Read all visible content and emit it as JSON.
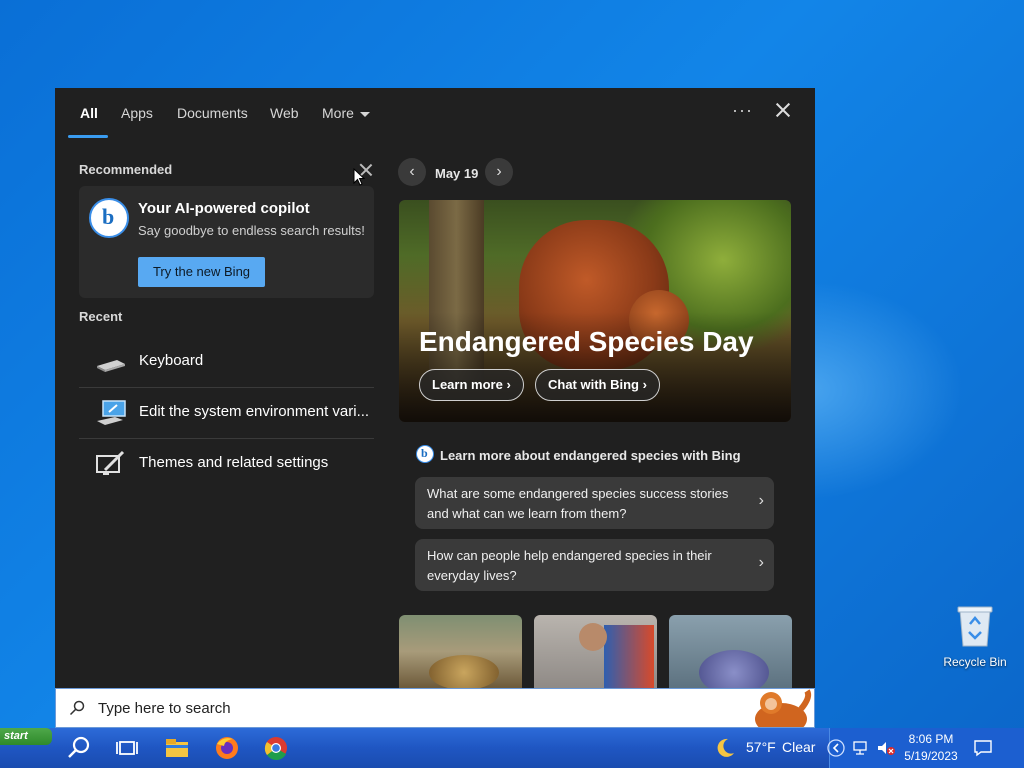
{
  "tabs": [
    {
      "label": "All",
      "active": true
    },
    {
      "label": "Apps"
    },
    {
      "label": "Documents"
    },
    {
      "label": "Web"
    },
    {
      "label": "More"
    }
  ],
  "recommended": {
    "title": "Recommended",
    "card": {
      "title": "Your AI-powered copilot",
      "subtitle": "Say goodbye to endless search results!",
      "button": "Try the new Bing"
    }
  },
  "recent": {
    "title": "Recent",
    "items": [
      {
        "label": "Keyboard",
        "icon": "keyboard-icon"
      },
      {
        "label": "Edit the system environment vari...",
        "icon": "system-properties-icon"
      },
      {
        "label": "Themes and related settings",
        "icon": "themes-icon"
      }
    ]
  },
  "highlight": {
    "date": "May 19",
    "title": "Endangered Species Day",
    "learn_more": "Learn more",
    "chat": "Chat with Bing"
  },
  "bing_section": {
    "title": "Learn more about endangered species with Bing",
    "questions": [
      "What are some endangered species success stories and what can we learn from them?",
      "How can people help endangered species in their everyday lives?"
    ]
  },
  "search": {
    "placeholder": "Type here to search"
  },
  "desktop": {
    "recycle_bin": "Recycle Bin"
  },
  "taskbar": {
    "start": "start",
    "weather": {
      "temp": "57°F",
      "condition": "Clear"
    },
    "clock": {
      "time": "8:06 PM",
      "date": "5/19/2023"
    }
  },
  "colors": {
    "accent": "#3a9cf0",
    "panel_bg": "#202020",
    "bing_button": "#58a9f2"
  }
}
